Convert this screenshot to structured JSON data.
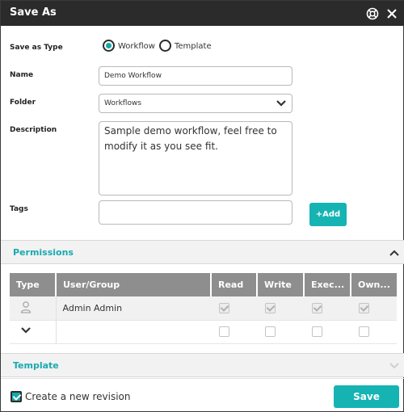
{
  "dialog": {
    "title": "Save As",
    "header_icons": [
      "lifesaver-icon",
      "close-icon"
    ]
  },
  "form": {
    "save_as_type_label": "Save as Type",
    "type_options": [
      {
        "label": "Workflow",
        "checked": true
      },
      {
        "label": "Template",
        "checked": false
      }
    ],
    "name_label": "Name",
    "name_value": "Demo Workflow",
    "folder_label": "Folder",
    "folder_value": "Workflows",
    "description_label": "Description",
    "description_value": "Sample demo workflow, feel free to modify it as you see fit.",
    "tags_label": "Tags",
    "tags_value": "",
    "add_button_label": "+Add"
  },
  "permissions": {
    "section_label": "Permissions",
    "expanded": true,
    "columns": [
      "Type",
      "User/Group",
      "Read",
      "Write",
      "Exec...",
      "Own..."
    ],
    "rows": [
      {
        "type_icon": "user-icon",
        "user_group": "Admin Admin",
        "read": true,
        "write": true,
        "exec": true,
        "own": true
      },
      {
        "type_icon": "chevron-down-icon",
        "user_group": "",
        "read": false,
        "write": false,
        "exec": false,
        "own": false
      }
    ]
  },
  "template": {
    "section_label": "Template",
    "expanded": false
  },
  "footer": {
    "create_revision_label": "Create a new revision",
    "create_revision_checked": true,
    "save_label": "Save"
  },
  "colors": {
    "accent": "#16b3b3",
    "titlebar": "#2b2b2b",
    "table_header": "#8e8e8e",
    "section_label": "#19a9b0"
  }
}
